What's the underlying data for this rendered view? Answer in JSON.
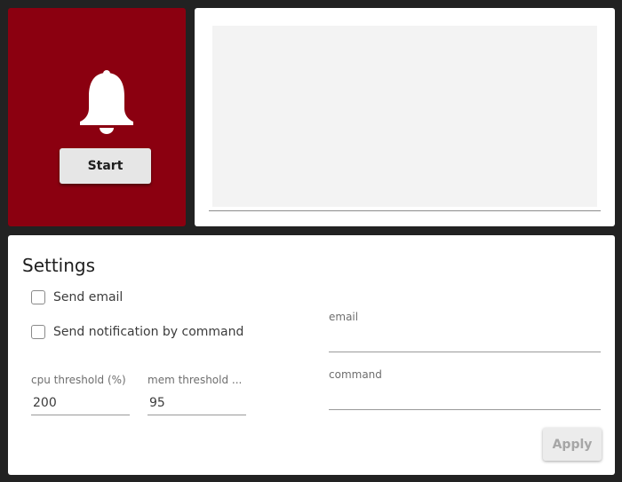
{
  "alarm": {
    "icon": "bell-icon",
    "start_label": "Start",
    "panel_color": "#8b0010"
  },
  "log": {
    "content": ""
  },
  "settings": {
    "title": "Settings",
    "send_email_label": "Send email",
    "send_email_checked": false,
    "send_command_label": "Send notification by command",
    "send_command_checked": false,
    "cpu_label": "cpu threshold (%)",
    "cpu_value": "200",
    "mem_label": "mem threshold ...",
    "mem_value": "95",
    "email_label": "email",
    "email_value": "",
    "command_label": "command",
    "command_value": "",
    "apply_label": "Apply",
    "apply_enabled": false
  }
}
